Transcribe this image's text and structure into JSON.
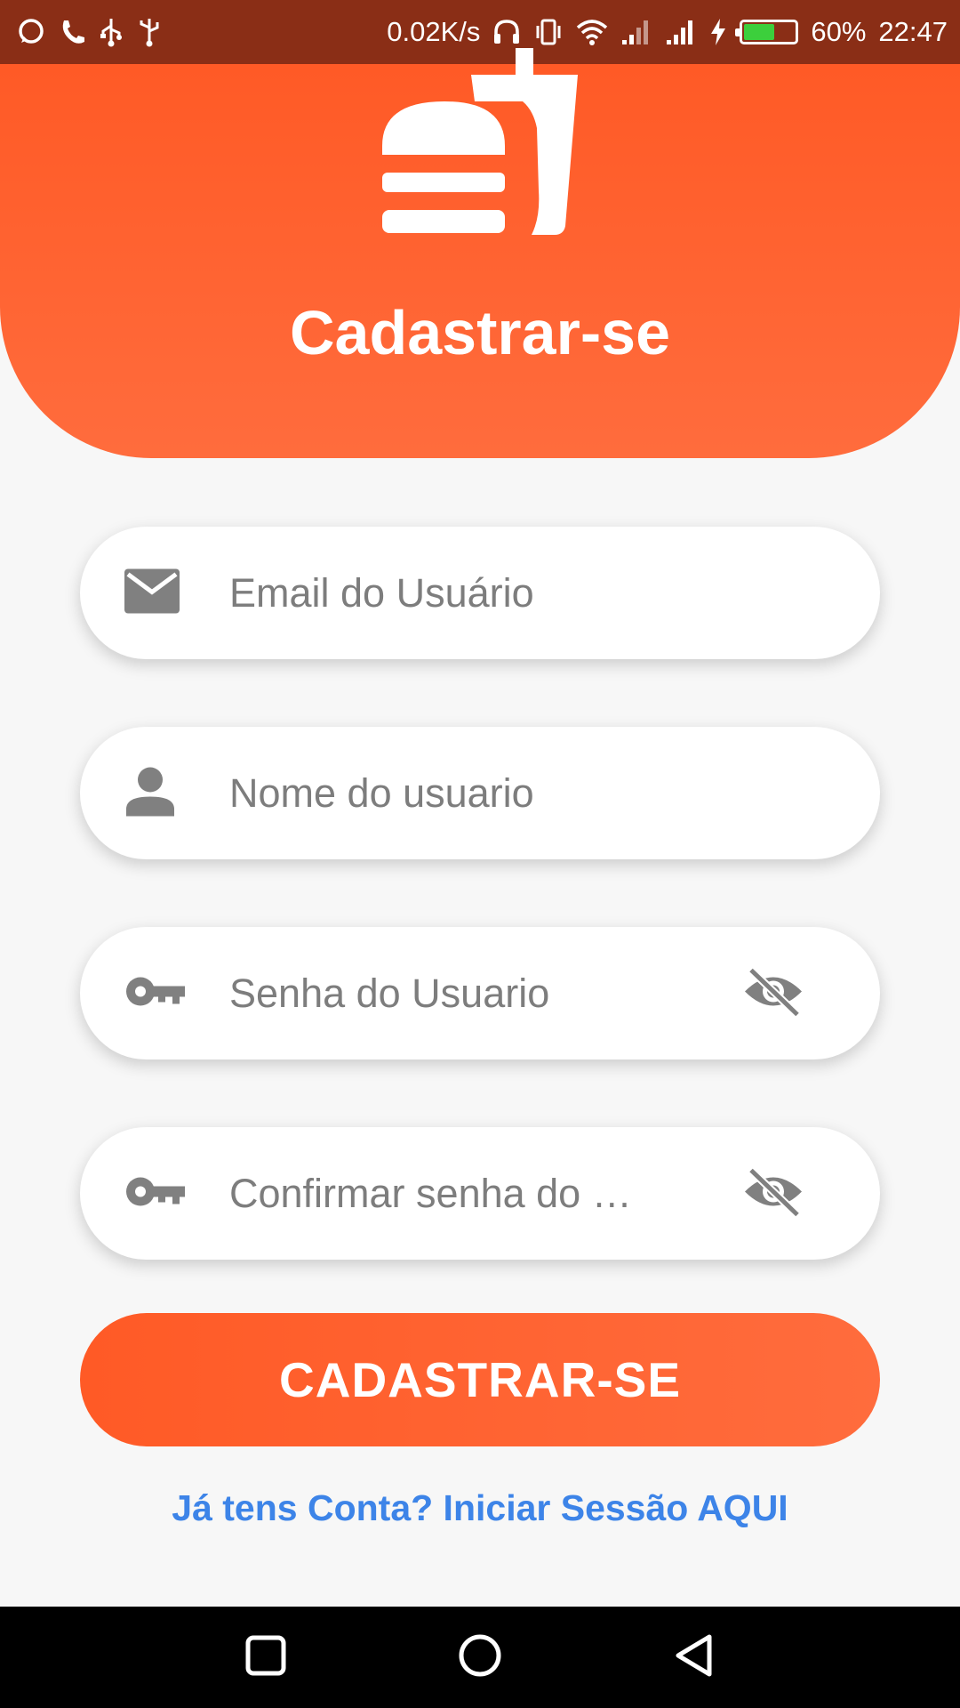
{
  "status_bar": {
    "net_speed": "0.02K/s",
    "battery_level": 0.6,
    "battery_percent": "60%",
    "time": "22:47"
  },
  "header": {
    "title": "Cadastrar-se",
    "accent_color": "#ff5a26"
  },
  "form": {
    "email": {
      "placeholder": "Email do Usuário",
      "icon": "email-icon"
    },
    "username": {
      "placeholder": "Nome do usuario",
      "icon": "person-icon"
    },
    "password": {
      "placeholder": "Senha do Usuario",
      "icon": "key-icon"
    },
    "confirm_password": {
      "placeholder": "Confirmar senha do …",
      "icon": "key-icon"
    },
    "submit_label": "CADASTRAR-SE",
    "login_link": "Já tens Conta? Iniciar Sessão AQUI",
    "link_color": "#3d84e8"
  }
}
